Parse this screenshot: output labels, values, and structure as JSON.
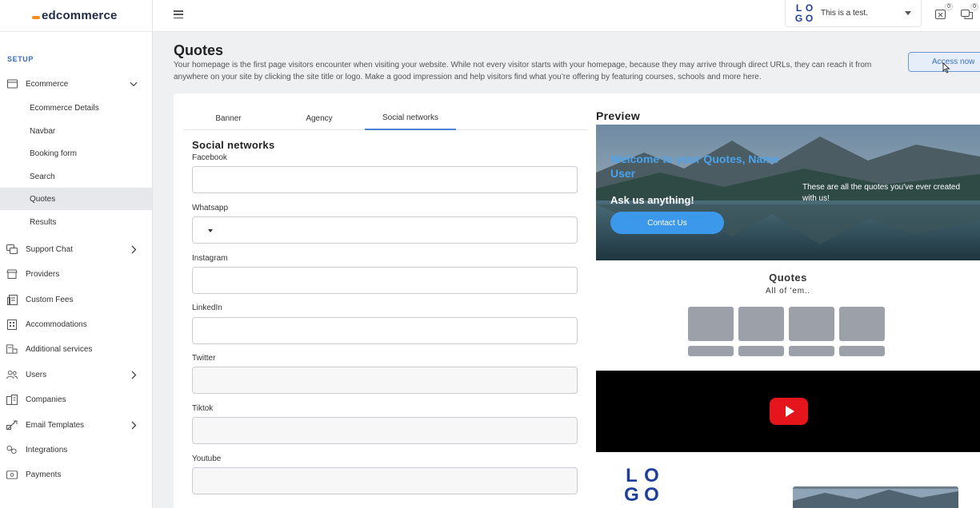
{
  "app": {
    "brand": "edcommerce"
  },
  "sidebar": {
    "section_label": "SETUP",
    "ecommerce": {
      "label": "Ecommerce",
      "icon": "storefront-icon"
    },
    "sub_items": [
      {
        "label": "Ecommerce Details"
      },
      {
        "label": "Navbar"
      },
      {
        "label": "Booking form"
      },
      {
        "label": "Search"
      },
      {
        "label": "Quotes",
        "active": true
      },
      {
        "label": "Results"
      }
    ],
    "items": [
      {
        "label": "Support Chat",
        "icon": "chat-icon",
        "has_children": true
      },
      {
        "label": "Providers",
        "icon": "store-icon"
      },
      {
        "label": "Custom Fees",
        "icon": "receipt-icon"
      },
      {
        "label": "Accommodations",
        "icon": "building-icon"
      },
      {
        "label": "Additional services",
        "icon": "services-icon"
      },
      {
        "label": "Users",
        "icon": "users-icon",
        "has_children": true
      },
      {
        "label": "Companies",
        "icon": "companies-icon"
      },
      {
        "label": "Email Templates",
        "icon": "email-icon",
        "has_children": true
      },
      {
        "label": "Integrations",
        "icon": "integrations-icon"
      },
      {
        "label": "Payments",
        "icon": "payments-icon"
      }
    ]
  },
  "topbar": {
    "site_name": "This is a test.",
    "logo_letters": [
      "L",
      "O",
      "G",
      "O"
    ],
    "notifications_count": "0",
    "messages_count": "0"
  },
  "page": {
    "title": "Quotes",
    "description": "Your homepage is the first page visitors encounter when visiting your website. While not every visitor starts with your homepage, because they may arrive through direct URLs, they can reach it from anywhere on your site by clicking the site title or logo. Make a good impression and help visitors find what you’re offering by featuring courses, schools and more here.",
    "access_button": "Access now"
  },
  "tabs": [
    {
      "label": "Banner"
    },
    {
      "label": "Agency"
    },
    {
      "label": "Social networks",
      "active": true
    }
  ],
  "form": {
    "title": "Social networks",
    "fields": [
      {
        "label": "Facebook",
        "value": ""
      },
      {
        "label": "Whatsapp",
        "value": ""
      },
      {
        "label": "Instagram",
        "value": ""
      },
      {
        "label": "LinkedIn",
        "value": ""
      },
      {
        "label": "Twitter",
        "value": ""
      },
      {
        "label": "Tiktok",
        "value": ""
      },
      {
        "label": "Youtube",
        "value": ""
      }
    ]
  },
  "preview": {
    "title": "Preview",
    "hero_welcome": "Welcome to your Quotes, Name User",
    "hero_ask": "Ask us anything!",
    "hero_button": "Contact Us",
    "hero_right_text": "These are all the quotes you've ever created with us!",
    "quotes_title": "Quotes",
    "quotes_subtitle": "All of 'em..",
    "video_icon": "youtube-play-icon",
    "footer_logo_letters": [
      "L",
      "O",
      "G",
      "O"
    ]
  },
  "colors": {
    "accent": "#4a80d6",
    "brand_orange": "#f28c1e",
    "logo_blue": "#1d3f9b",
    "youtube_red": "#e4161b",
    "hero_button": "#3c98ea"
  }
}
